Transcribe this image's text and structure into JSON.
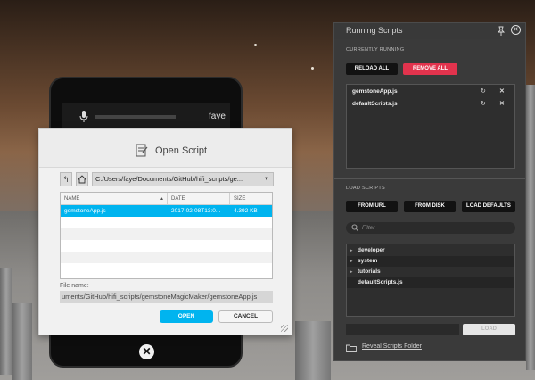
{
  "tablet": {
    "user_name": "faye",
    "close_glyph": "✕"
  },
  "dialog": {
    "title": "Open Script",
    "path": "C:/Users/faye/Documents/GitHub/hifi_scripts/ge...",
    "back_glyph": "↰",
    "columns": {
      "name": "NAME",
      "date": "DATE",
      "size": "SIZE"
    },
    "files": [
      {
        "name": "gemstoneApp.js",
        "date": "2017-02-08T13:0...",
        "size": "4.392 KB"
      }
    ],
    "file_name_label": "File name:",
    "file_name_value": "uments/GitHub/hifi_scripts/gemstoneMagicMaker/gemstoneApp.js",
    "open_label": "OPEN",
    "cancel_label": "CANCEL"
  },
  "panel": {
    "title": "Running Scripts",
    "close_glyph": "✕",
    "currently_running_label": "CURRENTLY RUNNING",
    "reload_all_label": "RELOAD ALL",
    "remove_all_label": "REMOVE ALL",
    "running": [
      {
        "name": "gemstoneApp.js",
        "reload_glyph": "↻",
        "remove_glyph": "✕"
      },
      {
        "name": "defaultScripts.js",
        "reload_glyph": "↻",
        "remove_glyph": "✕"
      }
    ],
    "load_scripts_label": "LOAD SCRIPTS",
    "from_url_label": "FROM URL",
    "from_disk_label": "FROM DISK",
    "load_defaults_label": "LOAD DEFAULTS",
    "filter_placeholder": "Filter",
    "tree": [
      {
        "label": "developer",
        "caret": "▸"
      },
      {
        "label": "system",
        "caret": "▸"
      },
      {
        "label": "tutorials",
        "caret": "▸"
      },
      {
        "label": "defaultScripts.js",
        "caret": ""
      }
    ],
    "load_label": "LOAD",
    "reveal_label": "Reveal Scripts Folder"
  },
  "colors": {
    "accent_blue": "#00b4ef",
    "remove_red": "#e2334d",
    "panel_bg": "#3a3a3a"
  }
}
